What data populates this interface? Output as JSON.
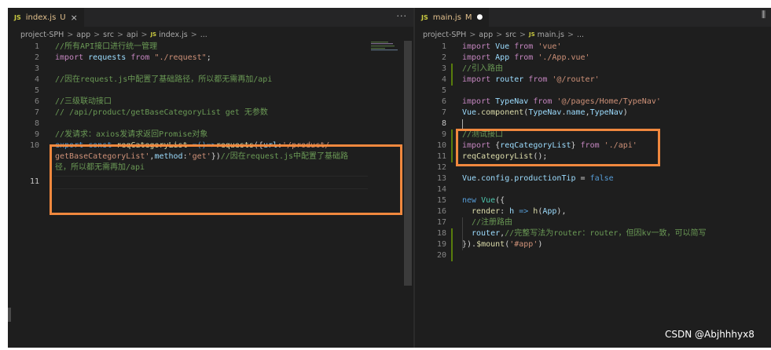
{
  "left_editor": {
    "tab": {
      "badge": "JS",
      "filename": "index.js",
      "git_status": "U",
      "close": "×"
    },
    "more_actions": "···",
    "breadcrumb": {
      "project": "project-SPH",
      "app": "app",
      "src": "src",
      "api": "api",
      "badge": "JS",
      "file": "index.js",
      "tail": "..."
    },
    "lines": [
      {
        "n": "1",
        "t": "//所有API接口进行统一管理"
      },
      {
        "n": "2",
        "a": "import",
        "b": " requests ",
        "c": "from",
        "d": " \"./request\"",
        "e": ";"
      },
      {
        "n": "3"
      },
      {
        "n": "4",
        "t": "//因在request.js中配置了基础路径，所以都无需再加/api"
      },
      {
        "n": "5"
      },
      {
        "n": "6",
        "t": "//三级联动接口"
      },
      {
        "n": "7",
        "t": "// /api/product/getBaseCategoryList get 无参数"
      },
      {
        "n": "8"
      },
      {
        "n": "9",
        "t": "//发请求：axios发请求返回Promise对象"
      },
      {
        "n": "10",
        "r1": {
          "a": "export",
          "b": " const ",
          "c": "reqCategoryList",
          "d": " =()=>",
          "e": "requests",
          "f": "({",
          "g": "url",
          "h": ":",
          "i": "'/product/"
        },
        "r2": {
          "a": "getBaseCategoryList'",
          "b": ",",
          "c": "method",
          "d": ":",
          "e": "'get'",
          "f": "})",
          "g": "//因在request.js中配置了基础路"
        },
        "r3": {
          "a": "径，所以都无需再加/api"
        }
      },
      {
        "n": "11"
      }
    ]
  },
  "right_editor": {
    "tab": {
      "badge": "JS",
      "filename": "main.js",
      "git_status": "M",
      "dirty": "●"
    },
    "breadcrumb": {
      "project": "project-SPH",
      "app": "app",
      "src": "src",
      "badge": "JS",
      "file": "main.js",
      "tail": "..."
    },
    "lines": [
      {
        "n": "1",
        "a": "import",
        "b": " Vue ",
        "c": "from",
        "d": " 'vue'"
      },
      {
        "n": "2",
        "a": "import",
        "b": " App ",
        "c": "from",
        "d": " './App.vue'"
      },
      {
        "n": "3",
        "t": "//引入路由"
      },
      {
        "n": "4",
        "a": "import",
        "b": " router ",
        "c": "from",
        "d": " '@/router'"
      },
      {
        "n": "5"
      },
      {
        "n": "6",
        "a": "import",
        "b": " TypeNav ",
        "c": "from",
        "d": " '@/pages/Home/TypeNav'"
      },
      {
        "n": "7",
        "a": "Vue",
        "b": ".",
        "c": "component",
        "d": "(",
        "e": "TypeNav",
        "f": ".",
        "g": "name",
        "h": ",",
        "i": "TypeNav",
        "j": ")"
      },
      {
        "n": "8"
      },
      {
        "n": "9",
        "t": "//测试接口"
      },
      {
        "n": "10",
        "a": "import",
        "b": " {",
        "c": "reqCategoryList",
        "d": "} ",
        "e": "from",
        "f": " './api'"
      },
      {
        "n": "11",
        "a": "reqCategoryList",
        "b": "();"
      },
      {
        "n": "12"
      },
      {
        "n": "13",
        "a": "Vue",
        "b": ".",
        "c": "config",
        "d": ".",
        "e": "productionTip",
        "f": " = ",
        "g": "false"
      },
      {
        "n": "14"
      },
      {
        "n": "15",
        "a": "new",
        "b": " Vue",
        "c": "({"
      },
      {
        "n": "16",
        "a": "render",
        "b": ": ",
        "c": "h",
        "d": " => ",
        "e": "h",
        "f": "(",
        "g": "App",
        "h": "),"
      },
      {
        "n": "17",
        "t": "//注册路由"
      },
      {
        "n": "18",
        "a": "router",
        "b": ",",
        "c": "//完整写法为router：router，但因kv一致，可以简写"
      },
      {
        "n": "19",
        "a": "}).",
        "b": "$mount",
        "c": "(",
        "d": "'#app'",
        "e": ")"
      },
      {
        "n": "20"
      }
    ]
  },
  "watermark": "CSDN @Abjhhhyx8",
  "colors": {
    "highlight_box": "#f0883e",
    "comment": "#6a9955",
    "keyword": "#c586c0",
    "string": "#ce9178",
    "variable": "#9cdcfe",
    "function": "#dcdcaa",
    "constant": "#569cd6",
    "class": "#4ec9b0",
    "editor_bg": "#1e1e1e"
  }
}
